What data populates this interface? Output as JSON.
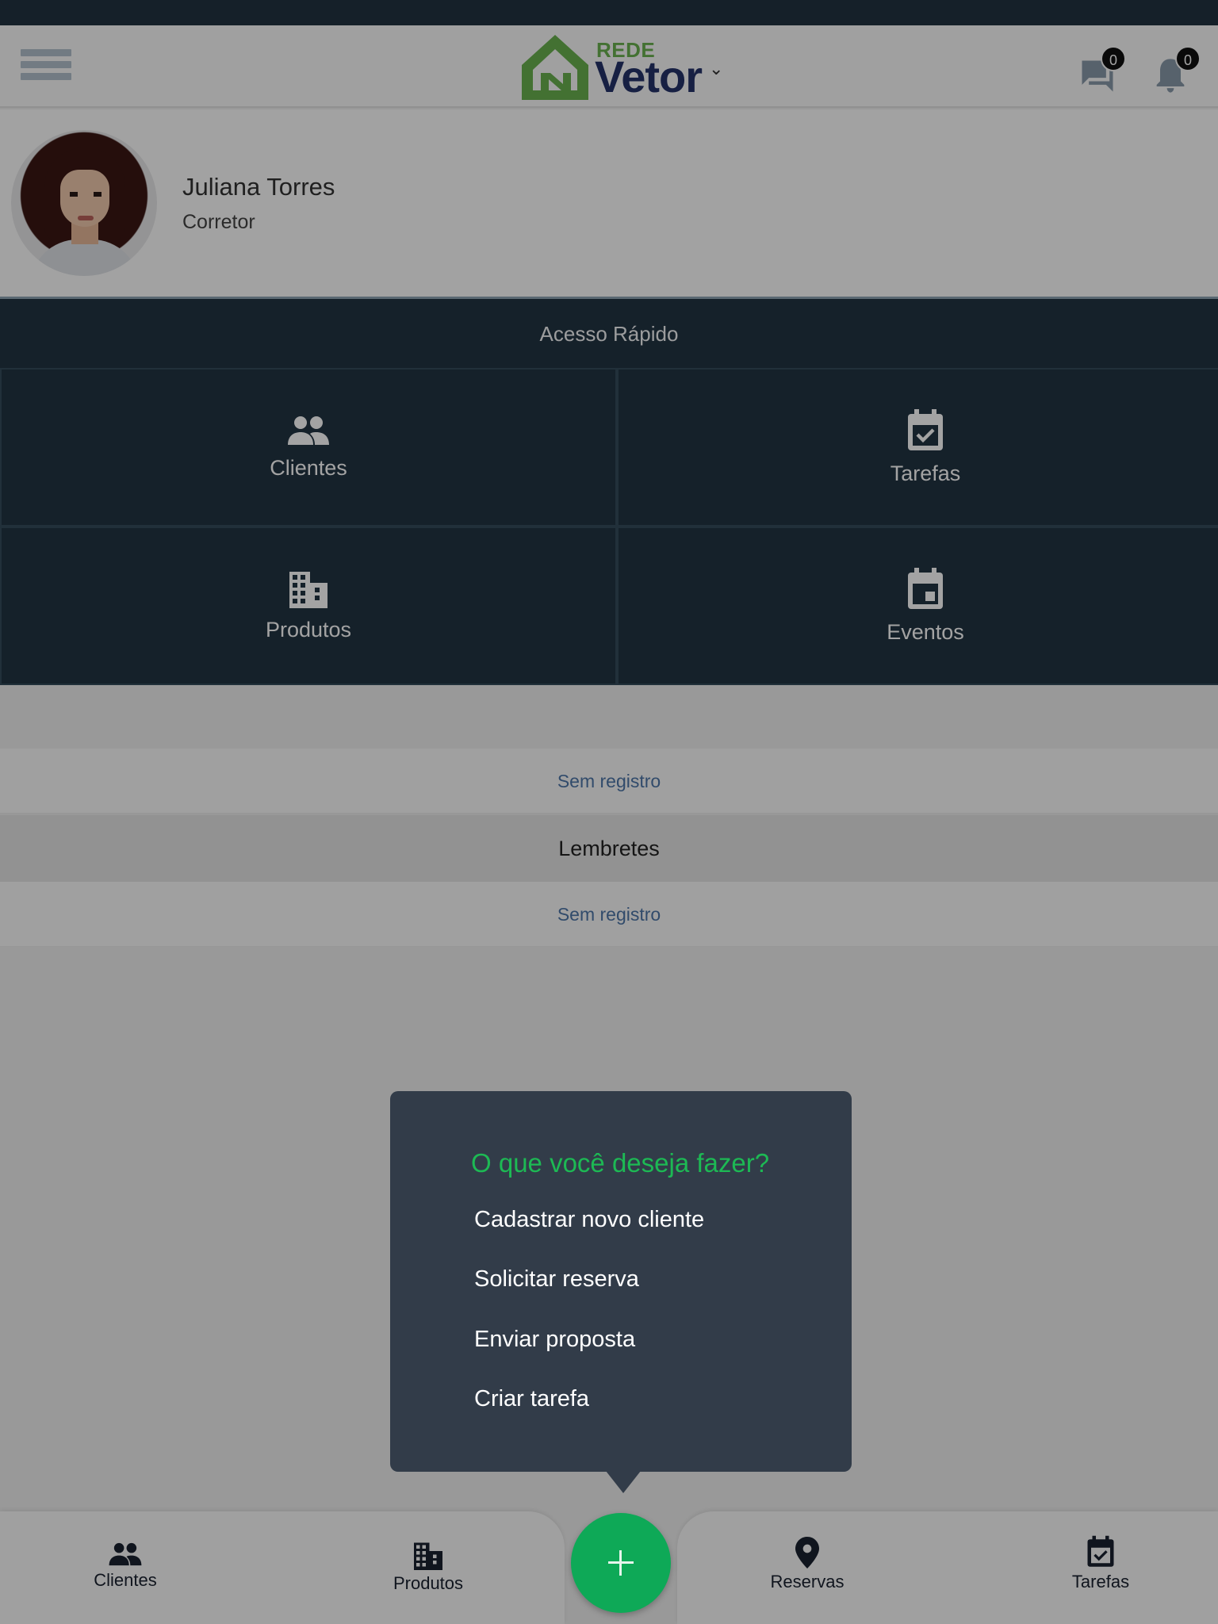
{
  "header": {
    "logo_small": "REDE",
    "logo_big": "Vetor",
    "messages_count": "0",
    "notifications_count": "0",
    "brand_green": "#6ab14f",
    "brand_navy": "#24326a"
  },
  "profile": {
    "name": "Juliana Torres",
    "role": "Corretor"
  },
  "quick_access": {
    "title": "Acesso Rápido",
    "tiles": [
      {
        "label": "Clientes",
        "icon": "people-icon"
      },
      {
        "label": "Tarefas",
        "icon": "calendar-check-icon"
      },
      {
        "label": "Produtos",
        "icon": "building-icon"
      },
      {
        "label": "Eventos",
        "icon": "event-icon"
      }
    ]
  },
  "lists": {
    "first_empty": "Sem registro",
    "reminders_title": "Lembretes",
    "reminders_empty": "Sem registro"
  },
  "popup": {
    "title": "O que você deseja fazer?",
    "items": [
      "Cadastrar novo cliente",
      "Solicitar reserva",
      "Enviar proposta",
      "Criar tarefa"
    ],
    "title_color": "#1db954"
  },
  "bottom_nav": {
    "items": [
      {
        "label": "Clientes",
        "icon": "people-icon"
      },
      {
        "label": "Produtos",
        "icon": "building-icon"
      },
      {
        "label": "Reservas",
        "icon": "location-pin-icon"
      },
      {
        "label": "Tarefas",
        "icon": "calendar-check-icon"
      }
    ],
    "fab_icon": "plus-icon",
    "fab_color": "#0ea957"
  }
}
